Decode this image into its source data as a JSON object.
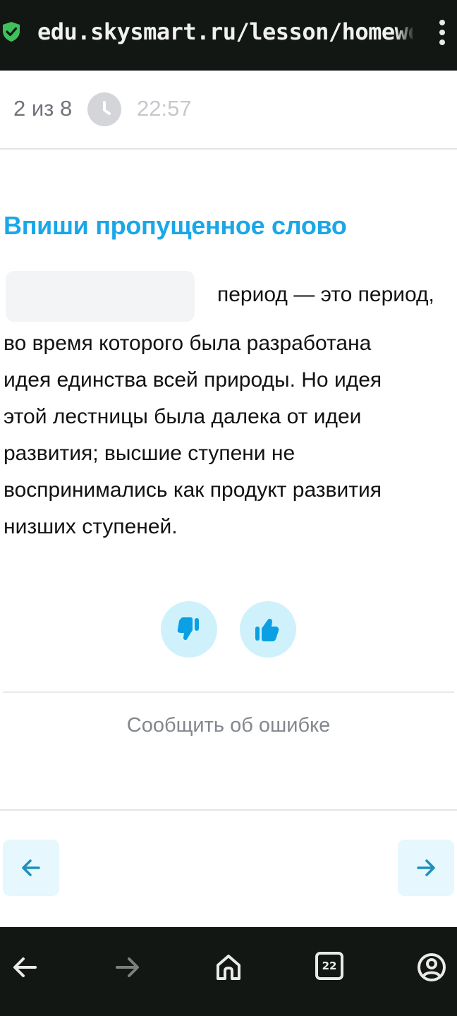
{
  "browser": {
    "url": "edu.skysmart.ru/lesson/homework",
    "tabs_count": "22",
    "icons": {
      "secure": "shield-check-icon",
      "menu": "kebab-menu-icon",
      "back": "arrow-left-icon",
      "forward": "arrow-right-icon",
      "home": "home-icon",
      "tabs": "tabs-icon",
      "profile": "profile-icon"
    }
  },
  "progress": {
    "counter": "2 из 8",
    "timer": "22:57",
    "clock_icon": "clock-icon"
  },
  "task": {
    "title": "Впиши пропущенное слово",
    "input_value": "",
    "first_line": "период — это период,",
    "lines": [
      "во время которого была разработана",
      "идея единства всей природы. Но идея",
      "этой лестницы была далека от идеи",
      "развития; высшие ступени не",
      "воспринимались как продукт развития",
      "низших ступеней."
    ]
  },
  "feedback": {
    "dislike_icon": "thumbs-down-icon",
    "like_icon": "thumbs-up-icon",
    "report_label": "Сообщить об ошибке"
  },
  "navigation": {
    "prev_icon": "arrow-left-icon",
    "next_icon": "arrow-right-icon"
  },
  "colors": {
    "accent": "#1aa7e8",
    "browser_bar": "#121714",
    "rating_bg": "#cff1fb",
    "nav_bg": "#e6f7fd"
  }
}
